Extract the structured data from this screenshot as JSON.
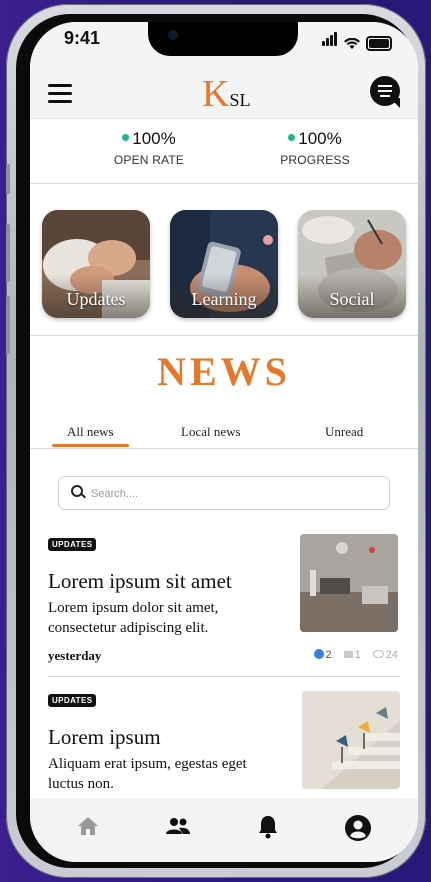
{
  "status": {
    "time": "9:41"
  },
  "header": {
    "logo_k": "K",
    "logo_rest": "SL"
  },
  "stats": [
    {
      "value": "100%",
      "label": "OPEN RATE"
    },
    {
      "value": "100%",
      "label": "PROGRESS"
    }
  ],
  "categories": [
    {
      "label": "Updates"
    },
    {
      "label": "Learning"
    },
    {
      "label": "Social"
    }
  ],
  "news": {
    "title": "NEWS",
    "tabs": [
      "All news",
      "Local news",
      "Unread"
    ],
    "active_tab": "All news",
    "search_placeholder": "Search...."
  },
  "articles": [
    {
      "badge": "UPDATES",
      "title": "Lorem ipsum sit amet",
      "excerpt": "Lorem ipsum dolor sit amet, consectetur adipiscing elit.",
      "time": "yesterday",
      "likes": "2",
      "comments": "1",
      "views": "24"
    },
    {
      "badge": "UPDATES",
      "title": "Lorem ipsum",
      "excerpt": "Aliquam erat ipsum, egestas eget luctus non."
    }
  ],
  "bottom_nav": [
    "home",
    "community",
    "notifications",
    "profile"
  ],
  "colors": {
    "accent": "#e8772a",
    "dot": "#1bb88f",
    "like": "#3d7fe0",
    "background": "#2c1a7c"
  }
}
